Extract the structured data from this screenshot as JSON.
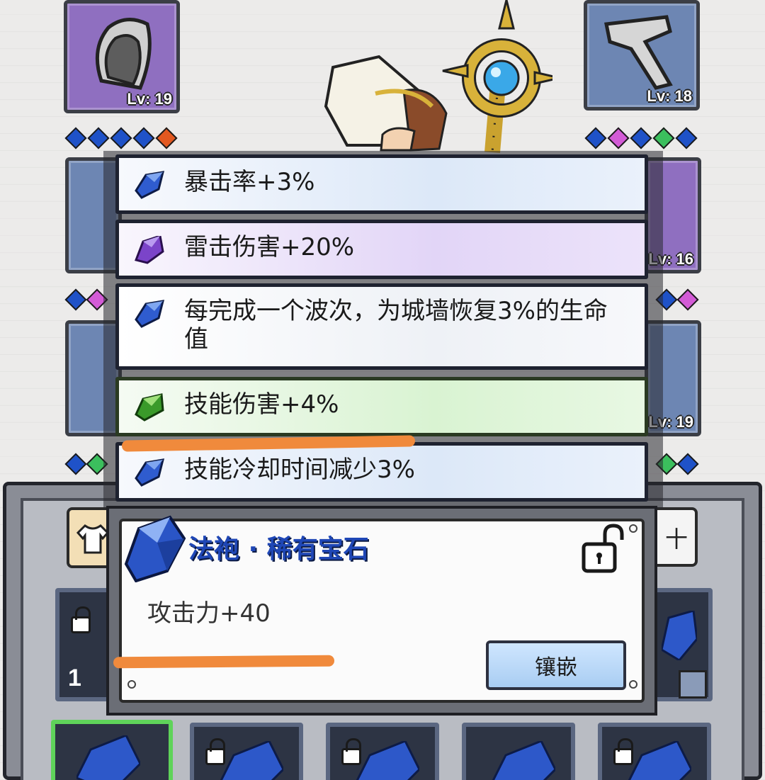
{
  "slots": [
    {
      "level": "Lv: 19"
    },
    {
      "level": "Lv: 18"
    },
    {
      "level": "Lv: 16"
    },
    {
      "level": "Lv: 19"
    }
  ],
  "colors": {
    "gem_blue": "#1f52c8",
    "gem_orange": "#e2581f",
    "gem_pink": "#d35bd6",
    "gem_green": "#3bbf5d",
    "title_blue": "#1f47b6",
    "highlight_orange": "#f08a3c"
  },
  "attributes": [
    {
      "text": "暴击率+3%",
      "gem": "blue-gem-icon"
    },
    {
      "text": "雷击伤害+20%",
      "gem": "purple-gem-icon"
    },
    {
      "text": "每完成一个波次，为城墙恢复3%的生命值",
      "gem": "blue-gem-icon"
    },
    {
      "text": "技能伤害+4%",
      "gem": "green-gem-icon"
    },
    {
      "text": "技能冷却时间减少3%",
      "gem": "blue-gem-icon"
    }
  ],
  "popup": {
    "title": "法袍 · 稀有宝石",
    "stat": "攻击力+40",
    "inlay_button": "镶嵌"
  },
  "inventory": {
    "left_count": "1",
    "right_tab_text": "十"
  }
}
